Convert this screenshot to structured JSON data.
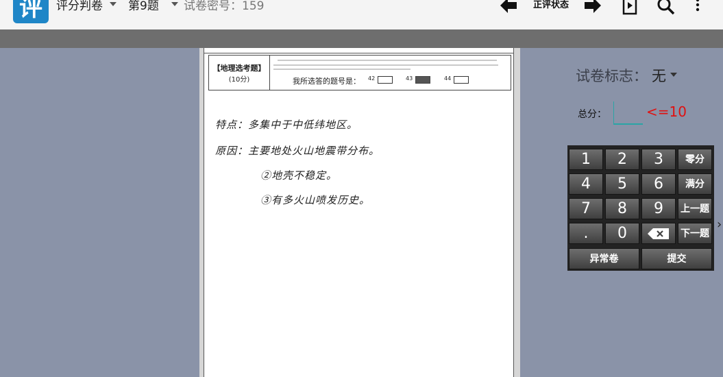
{
  "topbar": {
    "logo_char": "评",
    "app_title": "评分判卷",
    "question_label": "第9题",
    "paper_code_label": "试卷密号：159",
    "grading_status": "正评状态",
    "icons": [
      "back-arrow-icon",
      "forward-arrow-icon",
      "media-doc-icon",
      "search-icon",
      "more-icon"
    ]
  },
  "paper": {
    "header": {
      "title": "【地理选考题】",
      "score": "(10分)",
      "question_prompt": "我所选答的题号是：",
      "options": [
        {
          "number": "42",
          "selected": false
        },
        {
          "number": "43",
          "selected": true
        },
        {
          "number": "44",
          "selected": false
        }
      ]
    },
    "answer_lines": [
      "特点：多集中于中低纬地区。",
      "原因：主要地处火山地震带分布。",
      "②地壳不稳定。",
      "③有多火山喷发历史。"
    ]
  },
  "panel": {
    "flag_label": "试卷标志：",
    "flag_value": "无",
    "score_label": "总分：",
    "score_value": "",
    "score_limit": "<=10",
    "keypad": {
      "rows": [
        [
          "1",
          "2",
          "3",
          "零分"
        ],
        [
          "4",
          "5",
          "6",
          "满分"
        ],
        [
          "7",
          "8",
          "9",
          "上一题"
        ],
        [
          ".",
          "0",
          "backspace",
          "下一题"
        ]
      ],
      "bottom": [
        "异常卷",
        "提交"
      ]
    }
  },
  "colors": {
    "accent": "#1f86c7",
    "background": "#8a93a8",
    "limit_red": "#e01010",
    "input_teal": "#2aa5a5"
  }
}
